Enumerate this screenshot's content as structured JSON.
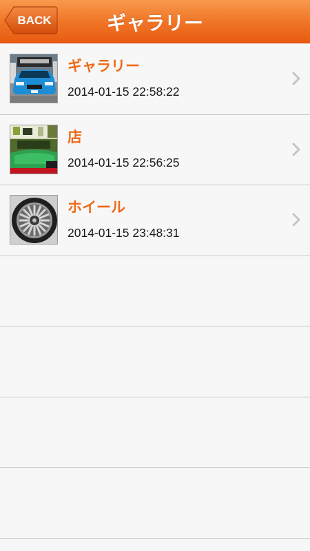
{
  "nav": {
    "back_label": "BACK",
    "title": "ギャラリー"
  },
  "gallery": {
    "items": [
      {
        "title": "ギャラリー",
        "date": "2014-01-15 22:58:22",
        "thumb_icon": "blue-car-photo"
      },
      {
        "title": "店",
        "date": "2014-01-15 22:56:25",
        "thumb_icon": "shop-interior-photo"
      },
      {
        "title": "ホイール",
        "date": "2014-01-15 23:48:31",
        "thumb_icon": "wheel-photo"
      }
    ]
  },
  "colors": {
    "accent": "#ee6a18",
    "navbar": "#f1792a"
  }
}
